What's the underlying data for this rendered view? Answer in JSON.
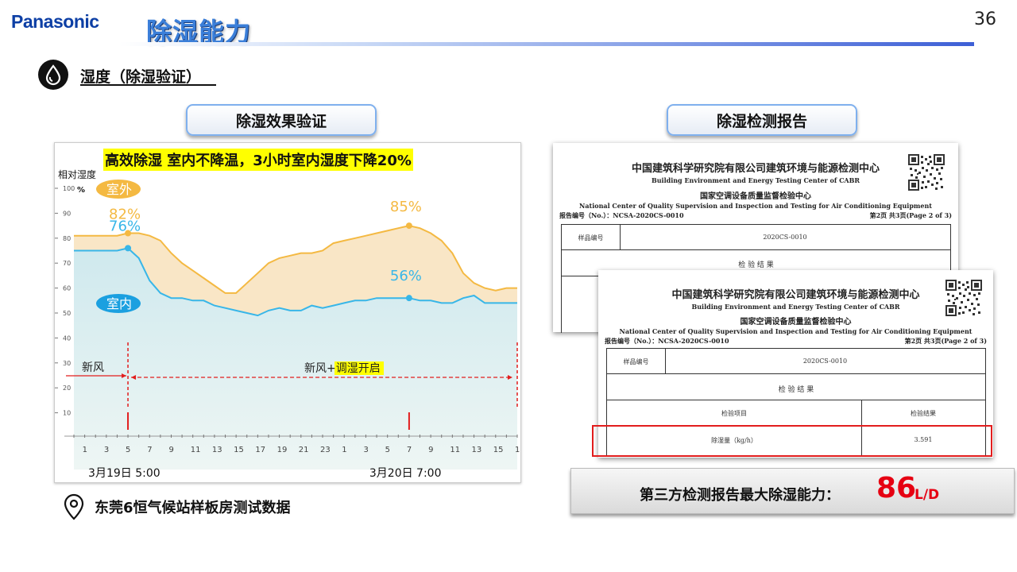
{
  "header": {
    "brand": "Panasonic",
    "title": "除湿能力",
    "page_number": "36"
  },
  "section": {
    "icon": "water-drop-icon",
    "title": "湿度（除湿验证）"
  },
  "left_panel": {
    "pill_label": "除湿效果验证",
    "headline": "高效除湿  室内不降温，3小时室内湿度下降20%",
    "location_icon": "map-pin-icon",
    "location": "东莞6恒气候站样板房测试数据"
  },
  "chart_data": {
    "type": "area",
    "ylabel": "相对湿度",
    "yunit": "%",
    "ylim": [
      0,
      100
    ],
    "yticks": [
      10,
      20,
      30,
      40,
      50,
      60,
      70,
      80,
      90,
      100
    ],
    "x_tick_labels": [
      "1",
      "3",
      "5",
      "7",
      "9",
      "11",
      "13",
      "15",
      "17",
      "19",
      "21",
      "23",
      "1",
      "3",
      "5",
      "7",
      "9",
      "11",
      "13",
      "15",
      "17"
    ],
    "date_labels": [
      {
        "text": "3月19日 5:00",
        "x_hour": 5
      },
      {
        "text": "3月20日 7:00",
        "x_hour": 31
      }
    ],
    "series": [
      {
        "name": "室外",
        "color": "#f4b942",
        "fill": "#f9e6c6",
        "x": [
          0,
          2,
          4,
          5,
          6,
          7,
          8,
          9,
          10,
          11,
          12,
          13,
          14,
          15,
          16,
          17,
          18,
          19,
          20,
          21,
          22,
          23,
          24,
          25,
          26,
          27,
          28,
          29,
          30,
          31,
          32,
          33,
          34,
          35,
          36,
          37,
          38,
          39,
          40,
          41
        ],
        "y": [
          81,
          81,
          81,
          82,
          82,
          81,
          79,
          74,
          70,
          67,
          64,
          61,
          58,
          58,
          62,
          66,
          70,
          72,
          73,
          74,
          74,
          75,
          78,
          79,
          80,
          81,
          82,
          83,
          84,
          85,
          84,
          82,
          79,
          74,
          66,
          62,
          60,
          59,
          60,
          60
        ]
      },
      {
        "name": "室内",
        "color": "#38b6e8",
        "fill": "#cdeaf2",
        "x": [
          0,
          2,
          4,
          5,
          6,
          7,
          8,
          9,
          10,
          11,
          12,
          13,
          14,
          15,
          16,
          17,
          18,
          19,
          20,
          21,
          22,
          23,
          24,
          25,
          26,
          27,
          28,
          29,
          30,
          31,
          32,
          33,
          34,
          35,
          36,
          37,
          38,
          39,
          40,
          41
        ],
        "y": [
          75,
          75,
          75,
          76,
          72,
          63,
          58,
          56,
          56,
          55,
          55,
          53,
          52,
          51,
          50,
          49,
          51,
          52,
          51,
          51,
          53,
          52,
          53,
          54,
          55,
          55,
          56,
          56,
          56,
          56,
          55,
          55,
          54,
          54,
          56,
          57,
          54,
          54,
          54,
          54
        ]
      }
    ],
    "legend": [
      {
        "text": "室外",
        "bg": "#f4b942"
      },
      {
        "text": "室内",
        "bg": "#1ba0e0"
      }
    ],
    "point_labels": [
      {
        "text": "82%",
        "series": 0,
        "x": 5,
        "y": 82
      },
      {
        "text": "85%",
        "series": 0,
        "x": 31,
        "y": 85
      },
      {
        "text": "76%",
        "series": 1,
        "x": 5,
        "y": 76
      },
      {
        "text": "56%",
        "series": 1,
        "x": 31,
        "y": 56
      }
    ],
    "events": [
      {
        "text": "新风",
        "x_start": 0,
        "x_end": 5
      },
      {
        "text_prefix": "新风+",
        "text_highlight": "调湿开启",
        "x_start": 5,
        "x_end": 41
      }
    ],
    "markers_x": [
      5,
      31
    ],
    "grid": false
  },
  "right_panel": {
    "pill_label": "除湿检测报告",
    "report": {
      "org_cn": "中国建筑科学研究院有限公司建筑环境与能源检测中心",
      "org_en": "Building Environment and Energy Testing Center of CABR",
      "center_cn": "国家空调设备质量监督检验中心",
      "center_en": "National Center of Quality Supervision and Inspection and Testing for Air Conditioning Equipment",
      "report_no": "报告编号（No.）：NCSA-2020CS-0010",
      "page": "第2页 共3页(Page 2 of 3)",
      "sample_label": "样品编号",
      "sample_value": "2020CS-0010",
      "result_heading": "检 验 结 果",
      "col_item": "检验项目",
      "col_result": "检验结果",
      "item": "除湿量（kg/h）",
      "value": "3.591"
    },
    "result_label": "第三方检测报告最大除湿能力：",
    "result_value": "86",
    "result_unit": "L/D"
  }
}
